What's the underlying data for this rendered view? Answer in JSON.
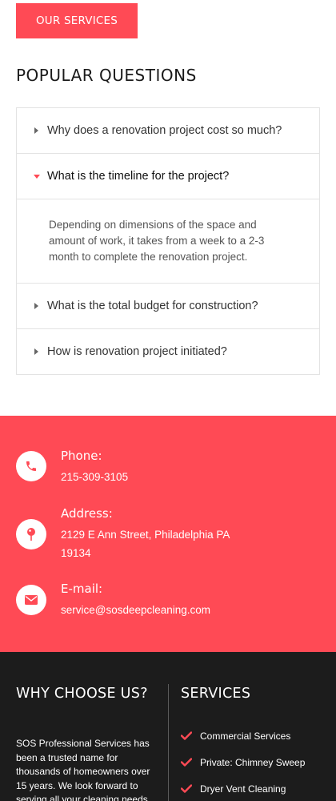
{
  "header": {
    "services_button": "OUR SERVICES"
  },
  "faq": {
    "title": "POPULAR QUESTIONS",
    "items": [
      {
        "question": "Why does a renovation project cost so much?",
        "open": false
      },
      {
        "question": "What is the timeline for the project?",
        "open": true,
        "answer": "Depending on dimensions of the space and amount of work, it takes from a week to a 2-3 month to complete the renovation project."
      },
      {
        "question": "What is the total budget for construction?",
        "open": false
      },
      {
        "question": "How is renovation project initiated?",
        "open": false
      }
    ]
  },
  "contact": {
    "background_color": "#ff4a55",
    "phone": {
      "label": "Phone:",
      "value": "215-309-3105",
      "icon": "phone-icon"
    },
    "address": {
      "label": "Address:",
      "value": "2129 E Ann Street, Philadelphia PA 19134",
      "icon": "map-pin-icon"
    },
    "email": {
      "label": "E-mail:",
      "value": "service@sosdeepcleaning.com",
      "icon": "envelope-icon"
    }
  },
  "footer": {
    "background_color": "#1c1c1c",
    "why_title": "WHY CHOOSE US?",
    "why_text": "SOS Professional Services has been a trusted name for thousands of homeowners over 15 years. We look forward to serving all your cleaning needs",
    "services_title": "SERVICES",
    "services": [
      "Commercial Services",
      "Private: Chimney Sweep",
      "Dryer Vent Cleaning"
    ]
  }
}
